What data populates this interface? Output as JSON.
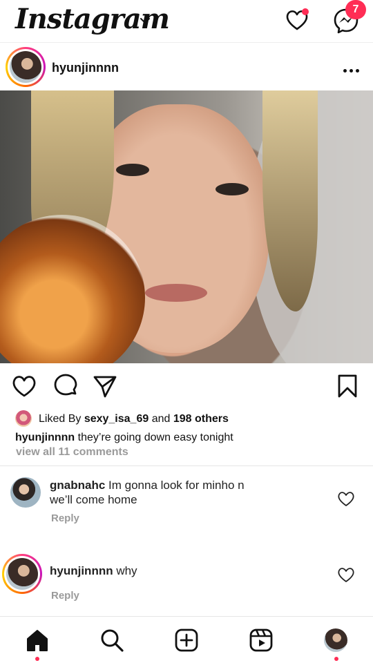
{
  "app": {
    "logo_text": "Instagram",
    "accent_color": "#ff2d55"
  },
  "top_bar": {
    "messages_badge_count": "7"
  },
  "post": {
    "username": "hyunjinnnn",
    "liked_prefix": "Liked By ",
    "liked_user": "sexy_isa_69",
    "liked_and": " and ",
    "liked_others": "198 others",
    "caption_user": "hyunjinnnn",
    "caption_text": " they’re going down easy tonight",
    "view_comments": "view all 11 comments"
  },
  "comments": [
    {
      "username": "gnabnahc",
      "text_line1": " Im gonna look for minho n",
      "text_line2": "we’ll come home",
      "reply_label": "Reply"
    },
    {
      "username": "hyunjinnnn",
      "text_line1": " why",
      "reply_label": "Reply"
    }
  ],
  "bottom_nav": {
    "items": [
      "home-icon",
      "search-icon",
      "create-icon",
      "reels-icon",
      "profile-avatar"
    ]
  }
}
